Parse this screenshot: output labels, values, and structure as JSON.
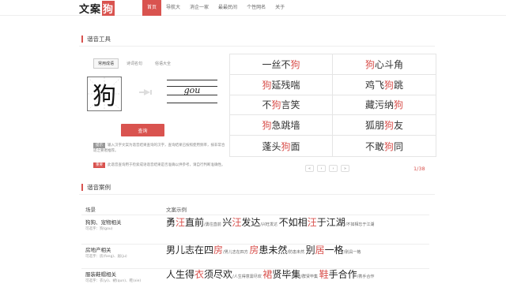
{
  "header": {
    "logo_text": "文案",
    "logo_highlight": "狗",
    "nav": [
      "首页",
      "导航大",
      "消企一家",
      "最最民间",
      "个性网名",
      "关于"
    ],
    "active_nav_index": 0
  },
  "tool_section": {
    "title": "谐音工具",
    "tabs": [
      "常用成语",
      "诗词名句",
      "俗语大全"
    ],
    "active_tab_index": 0,
    "input_char": "狗",
    "pinyin": "gou",
    "query_button": "查询",
    "tip1_tag": "提示",
    "tip1_text": "输入汉字文案为谐音结果查询的汉字，查询结果已按照使用频率，按非常合适之要者推荐。",
    "tip2_tag": "重要",
    "tip2_text": "此谐音查询用于检索成语谐音结果是否准确以供参考，请自行判断准确性。"
  },
  "idioms": [
    {
      "pre": "一丝不",
      "hl": "狗",
      "post": ""
    },
    {
      "pre": "",
      "hl": "狗",
      "post": "心斗角"
    },
    {
      "pre": "",
      "hl": "狗",
      "post": "延残喘"
    },
    {
      "pre": "鸡飞",
      "hl": "狗",
      "post": "跳"
    },
    {
      "pre": "不",
      "hl": "狗",
      "post": "言笑"
    },
    {
      "pre": "藏污纳",
      "hl": "狗",
      "post": ""
    },
    {
      "pre": "",
      "hl": "狗",
      "post": "急跳墙"
    },
    {
      "pre": "狐朋",
      "hl": "狗",
      "post": "友"
    },
    {
      "pre": "蓬头",
      "hl": "狗",
      "post": "面"
    },
    {
      "pre": "不敢",
      "hl": "狗",
      "post": "同"
    }
  ],
  "pager": {
    "buttons": [
      "«",
      "‹",
      "›",
      "»"
    ],
    "count": "1/38"
  },
  "case_section": {
    "title": "谐音案例",
    "col_scene": "场景",
    "col_example": "文案示例",
    "rows": [
      {
        "scene": "狗狗、宠物相关",
        "sub": "可选字：狗(gou)",
        "parts": [
          {
            "t": "勇",
            "c": "big"
          },
          {
            "t": "汪",
            "c": "big hl"
          },
          {
            "t": "直前",
            "c": "big"
          },
          {
            "t": "/勇往直前 ",
            "c": "small"
          },
          {
            "t": "兴",
            "c": "big"
          },
          {
            "t": "汪",
            "c": "big hl"
          },
          {
            "t": "发达",
            "c": "big"
          },
          {
            "t": "/兴旺发达 ",
            "c": "small"
          },
          {
            "t": "不如相",
            "c": "big"
          },
          {
            "t": "汪",
            "c": "big hl"
          },
          {
            "t": "于江湖",
            "c": "big"
          },
          {
            "t": "/不如相忘于江湖",
            "c": "small"
          }
        ]
      },
      {
        "scene": "房地产相关",
        "sub": "可选字：房(fang)、居(ju)",
        "parts": [
          {
            "t": "男儿志在四",
            "c": "big"
          },
          {
            "t": "房",
            "c": "big hl"
          },
          {
            "t": "/男儿志在四方 ",
            "c": "small"
          },
          {
            "t": "房",
            "c": "big hl"
          },
          {
            "t": "患未然",
            "c": "big"
          },
          {
            "t": "/防患未然 ",
            "c": "small"
          },
          {
            "t": "别",
            "c": "big"
          },
          {
            "t": "居",
            "c": "big hl"
          },
          {
            "t": "一格",
            "c": "big"
          },
          {
            "t": "/别具一格",
            "c": "small"
          }
        ]
      },
      {
        "scene": "服装鞋帽相关",
        "sub": "可选字：衣(yi)、裙(qun)、鞋(xie)",
        "parts": [
          {
            "t": "人生得",
            "c": "big"
          },
          {
            "t": "衣",
            "c": "big hl"
          },
          {
            "t": "须尽欢",
            "c": "big"
          },
          {
            "t": "/人生得意需尽欢 ",
            "c": "small"
          },
          {
            "t": "裙",
            "c": "big hl"
          },
          {
            "t": "贤毕集",
            "c": "big"
          },
          {
            "t": "/群贤毕集 ",
            "c": "small"
          },
          {
            "t": "鞋",
            "c": "big hl"
          },
          {
            "t": "手合作",
            "c": "big"
          },
          {
            "t": "/携手合作",
            "c": "small"
          }
        ]
      }
    ]
  },
  "colors": {
    "accent": "#d9534f"
  }
}
